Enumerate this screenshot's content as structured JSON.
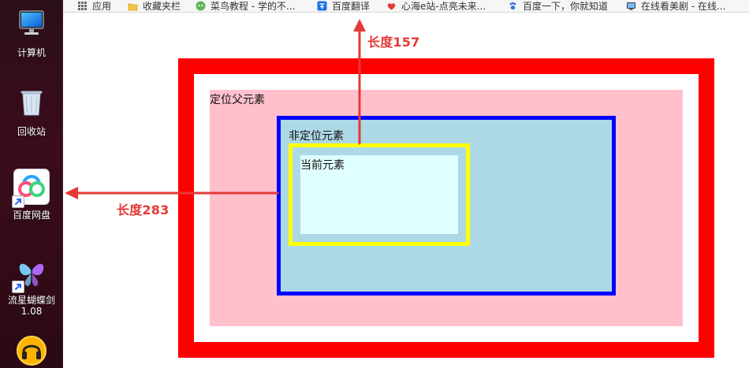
{
  "desktop": {
    "items": [
      {
        "name": "computer",
        "label": "计算机",
        "icon": "computer-icon"
      },
      {
        "name": "recycle-bin",
        "label": "回收站",
        "icon": "recycle-bin-icon"
      },
      {
        "name": "baidu-netdisk",
        "label": "百度网盘",
        "icon": "baidu-netdisk-icon"
      },
      {
        "name": "meteor-butterfly-sword",
        "label": "流星蝴蝶剑\n1.08",
        "icon": "butterfly-icon"
      },
      {
        "name": "partial",
        "label": "",
        "icon": "headset-icon"
      }
    ]
  },
  "browser": {
    "bookmarks": [
      {
        "label": "应用",
        "icon": "apps-icon"
      },
      {
        "label": "收藏夹栏",
        "icon": "folder-icon"
      },
      {
        "label": "菜鸟教程 - 学的不...",
        "icon": "runoob-icon"
      },
      {
        "label": "百度翻译",
        "icon": "baidu-translate-icon"
      },
      {
        "label": "心海e站-点亮未来...",
        "icon": "heart-icon"
      },
      {
        "label": "百度一下，你就知道",
        "icon": "baidu-paw-icon"
      },
      {
        "label": "在线看美剧 - 在线...",
        "icon": "tv-icon"
      }
    ]
  },
  "demo": {
    "labels": {
      "positioned_parent": "定位父元素",
      "non_positioned": "非定位元素",
      "current": "当前元素"
    },
    "annotations": {
      "top_length": "长度157",
      "left_length": "长度283"
    },
    "colors": {
      "outer_border": "#ff0000",
      "parent_bg": "#ffc0cb",
      "blue_border": "#0000ff",
      "blue_bg": "#add8e6",
      "yellow_border": "#ffff00",
      "current_bg": "#e0ffff",
      "annotation": "#e53935"
    }
  }
}
